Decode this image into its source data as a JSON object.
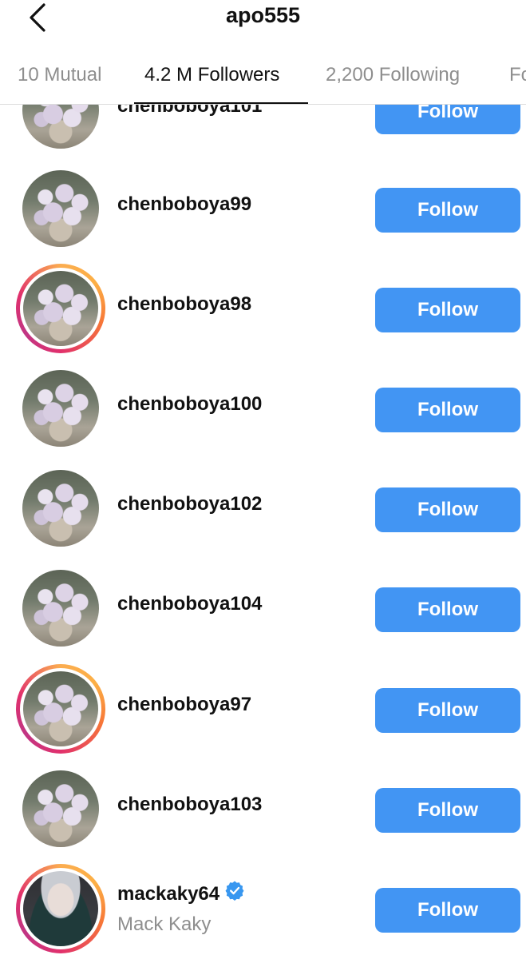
{
  "header": {
    "title": "apo555",
    "back_icon": "chevron-left-icon"
  },
  "tabs": [
    {
      "label": "10 Mutual",
      "active": false
    },
    {
      "label": "4.2 M Followers",
      "active": true
    },
    {
      "label": "2,200 Following",
      "active": false
    },
    {
      "label": "Fo",
      "active": false
    }
  ],
  "list": {
    "follow_label": "Follow",
    "button_color": "#4295f3",
    "items": [
      {
        "username": "chenboboya101",
        "story_ring": false
      },
      {
        "username": "chenboboya99",
        "story_ring": false
      },
      {
        "username": "chenboboya98",
        "story_ring": true
      },
      {
        "username": "chenboboya100",
        "story_ring": false
      },
      {
        "username": "chenboboya102",
        "story_ring": false
      },
      {
        "username": "chenboboya104",
        "story_ring": false
      },
      {
        "username": "chenboboya97",
        "story_ring": true
      },
      {
        "username": "chenboboya103",
        "story_ring": false
      },
      {
        "username": "mackaky64",
        "full_name": "Mack Kaky",
        "verified": true,
        "story_ring": true
      }
    ]
  }
}
